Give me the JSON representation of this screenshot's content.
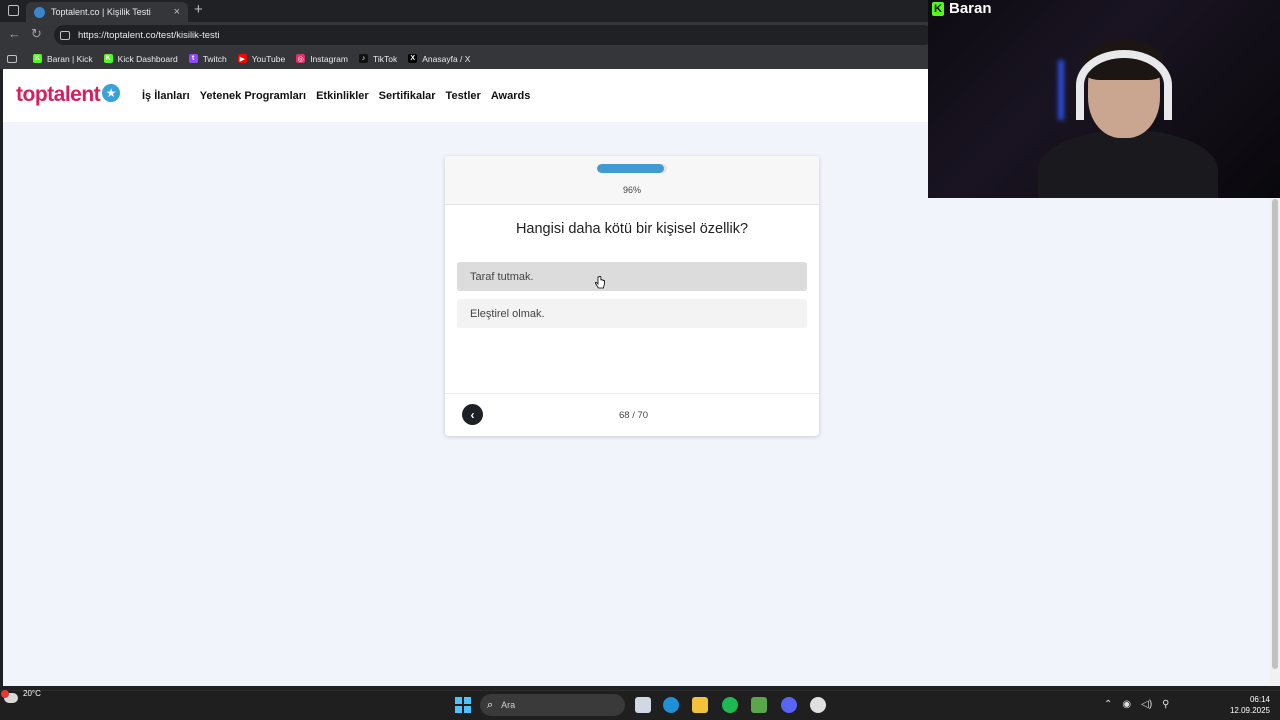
{
  "browser": {
    "tab_title": "Toptalent.co | Kişilik Testi",
    "tab_close": "×",
    "new_tab": "+",
    "url": "https://toptalent.co/test/kisilik-testi",
    "back": "←",
    "reload": "↻",
    "bookmarks": [
      {
        "label": "Baran | Kick",
        "icon": "kick-icon",
        "color": "#53fc18",
        "glyph": "K"
      },
      {
        "label": "Kick Dashboard",
        "icon": "kick-icon",
        "color": "#53fc18",
        "glyph": "K"
      },
      {
        "label": "Twitch",
        "icon": "twitch-icon",
        "color": "#9146ff",
        "glyph": "t"
      },
      {
        "label": "YouTube",
        "icon": "youtube-icon",
        "color": "#ff0000",
        "glyph": "▶"
      },
      {
        "label": "Instagram",
        "icon": "instagram-icon",
        "color": "#e1306c",
        "glyph": "◎"
      },
      {
        "label": "TikTok",
        "icon": "tiktok-icon",
        "color": "#111111",
        "glyph": "♪"
      },
      {
        "label": "Anasayfa / X",
        "icon": "x-icon",
        "color": "#000000",
        "glyph": "X"
      }
    ]
  },
  "webcam": {
    "name": "Baran",
    "brand_color": "#53fc18"
  },
  "site": {
    "logo": "toptalent",
    "logo_color": "#d81f5b",
    "nav": [
      "İş İlanları",
      "Yetenek Programları",
      "Etkinlikler",
      "Sertifikalar",
      "Testler",
      "Awards"
    ]
  },
  "test": {
    "progress": 0.96,
    "progress_label": "96%",
    "question": "Hangisi daha kötü bir kişisel özellik?",
    "options": [
      "Taraf tutmak.",
      "Eleştirel olmak."
    ],
    "counter": "68 / 70",
    "back_glyph": "‹"
  },
  "taskbar": {
    "temperature": "20°C",
    "weather_badge": "6",
    "search_placeholder": "Ara",
    "time": "06:14",
    "date": "12.09.2025"
  }
}
